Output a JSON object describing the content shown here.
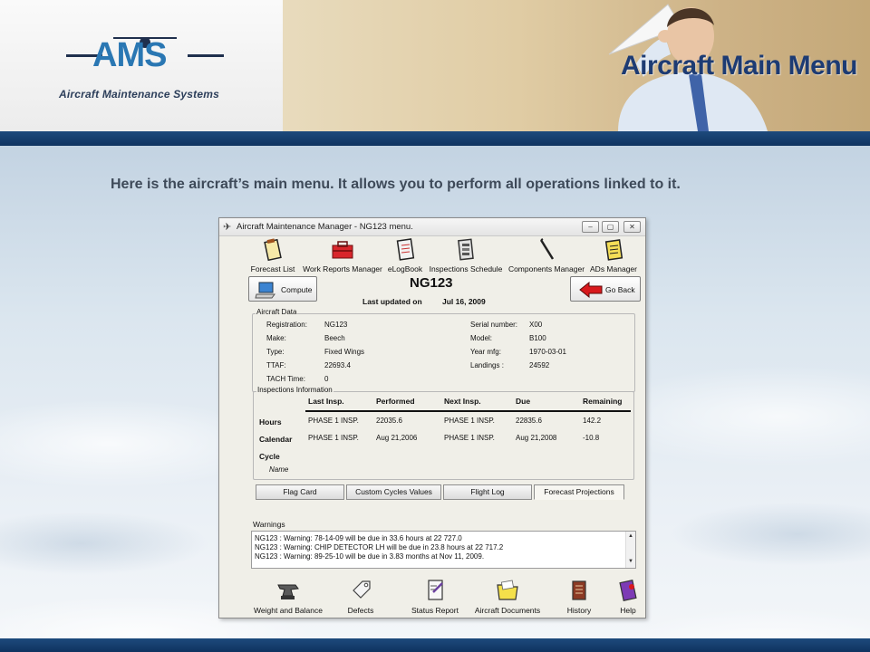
{
  "header": {
    "logo_letters": "AMS",
    "logo_text": "Aircraft Maintenance Systems",
    "page_heading": "Aircraft Main Menu"
  },
  "subtitle": "Here is the aircraft’s main menu. It allows you to perform all operations linked to it.",
  "window": {
    "title": "Aircraft Maintenance Manager - NG123 menu.",
    "toolbar": [
      {
        "label": "Forecast List",
        "icon": "clipboard-icon"
      },
      {
        "label": "Work Reports Manager",
        "icon": "toolbox-icon"
      },
      {
        "label": "eLogBook",
        "icon": "logbook-icon"
      },
      {
        "label": "Inspections Schedule",
        "icon": "schedule-icon"
      },
      {
        "label": "Components Manager",
        "icon": "component-icon"
      },
      {
        "label": "ADs Manager",
        "icon": "notepad-icon"
      }
    ],
    "compute_label": "Compute",
    "go_back_label": "Go Back",
    "aircraft_title": "NG123",
    "last_updated_label": "Last updated on",
    "last_updated_value": "Jul 16, 2009",
    "aircraft_data": {
      "group_label": "Aircraft Data",
      "left": [
        {
          "label": "Registration:",
          "value": "NG123"
        },
        {
          "label": "Make:",
          "value": "Beech"
        },
        {
          "label": "Type:",
          "value": "Fixed Wings"
        },
        {
          "label": "TTAF:",
          "value": "22693.4"
        },
        {
          "label": "TACH Time:",
          "value": "0"
        }
      ],
      "right": [
        {
          "label": "Serial number:",
          "value": "X00"
        },
        {
          "label": "Model:",
          "value": "B100"
        },
        {
          "label": "Year mfg:",
          "value": "1970-03-01"
        },
        {
          "label": "Landings :",
          "value": "24592"
        }
      ]
    },
    "inspections": {
      "group_label": "Inspections Information",
      "headers": [
        "Last Insp.",
        "Performed",
        "Next Insp.",
        "Due",
        "Remaining"
      ],
      "rows": [
        {
          "label": "Hours",
          "cells": [
            "PHASE 1 INSP.",
            "22035.6",
            "PHASE 1 INSP.",
            "22835.6",
            "142.2"
          ]
        },
        {
          "label": "Calendar",
          "cells": [
            "PHASE 1 INSP.",
            "Aug 21,2006",
            "PHASE 1 INSP.",
            "Aug 21,2008",
            "-10.8"
          ]
        },
        {
          "label": "Cycle",
          "cells": []
        }
      ],
      "name_label": "Name"
    },
    "tabs": [
      {
        "label": "Flag Card",
        "active": false
      },
      {
        "label": "Custom Cycles Values",
        "active": false
      },
      {
        "label": "Flight Log",
        "active": false
      },
      {
        "label": "Forecast Projections",
        "active": true
      }
    ],
    "warnings_label": "Warnings",
    "warnings": [
      "NG123 : Warning: 78-14-09 will be due in 33.6 hours at 22 727.0",
      "NG123 : Warning: CHIP DETECTOR LH will be due in 23.8 hours at 22 717.2",
      "NG123 : Warning: 89-25-10 will be due in 3.83 months at Nov 11, 2009."
    ],
    "bottom_toolbar": [
      {
        "label": "Weight and Balance",
        "icon": "anvil-icon"
      },
      {
        "label": "Defects",
        "icon": "tag-icon"
      },
      {
        "label": "Status Report",
        "icon": "report-icon"
      },
      {
        "label": "Aircraft Documents",
        "icon": "folder-icon"
      },
      {
        "label": "History",
        "icon": "history-book-icon"
      },
      {
        "label": "Help",
        "icon": "help-book-icon"
      }
    ]
  },
  "colors": {
    "brand_blue": "#1d3b73",
    "band_blue": "#14406e",
    "logo_blue": "#2a77b3"
  }
}
